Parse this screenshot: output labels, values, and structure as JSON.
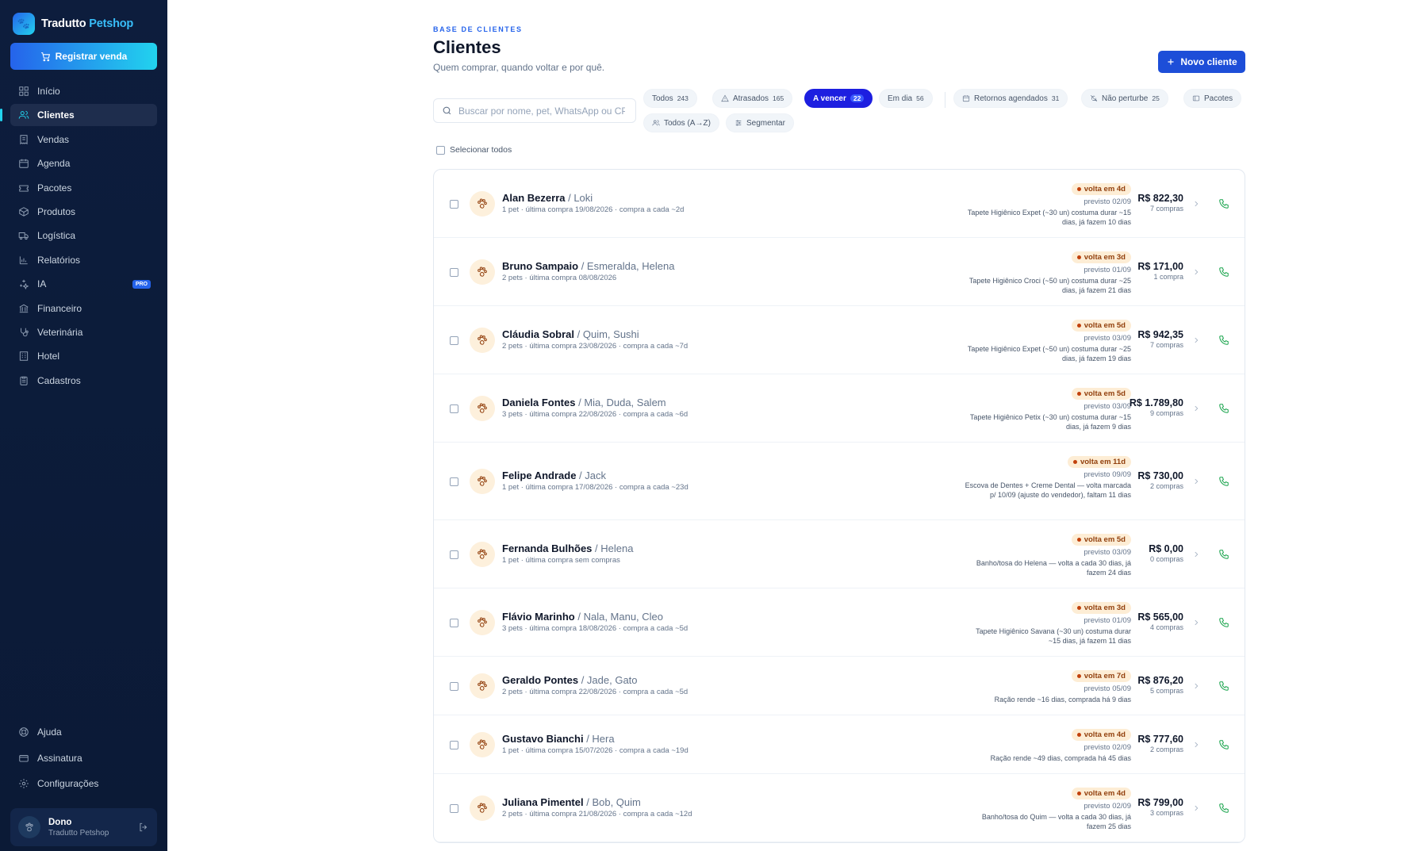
{
  "brand": {
    "name": "Tradutto",
    "accent": "Petshop"
  },
  "sidebar": {
    "register_label": "Registrar venda",
    "items": [
      {
        "label": "Início",
        "icon": "home-icon"
      },
      {
        "label": "Clientes",
        "icon": "users-icon",
        "active": true
      },
      {
        "label": "Vendas",
        "icon": "receipt-icon"
      },
      {
        "label": "Agenda",
        "icon": "calendar-icon"
      },
      {
        "label": "Pacotes",
        "icon": "ticket-icon"
      },
      {
        "label": "Produtos",
        "icon": "box-icon"
      },
      {
        "label": "Logística",
        "icon": "truck-icon"
      },
      {
        "label": "Relatórios",
        "icon": "bar-chart-icon"
      },
      {
        "label": "IA",
        "icon": "sparkles-icon",
        "badge": "PRO"
      },
      {
        "label": "Financeiro",
        "icon": "bank-icon"
      },
      {
        "label": "Veterinária",
        "icon": "stethoscope-icon"
      },
      {
        "label": "Hotel",
        "icon": "building-icon"
      },
      {
        "label": "Cadastros",
        "icon": "clipboard-icon"
      }
    ],
    "bottom_items": [
      {
        "label": "Ajuda",
        "icon": "help-icon"
      },
      {
        "label": "Assinatura",
        "icon": "credit-card-icon"
      },
      {
        "label": "Configurações",
        "icon": "gear-icon"
      }
    ],
    "user": {
      "name": "Dono",
      "sub": "Tradutto Petshop"
    }
  },
  "header": {
    "eyebrow": "BASE DE CLIENTES",
    "title": "Clientes",
    "subtitle": "Quem comprar, quando voltar e por quê.",
    "new_label": "Novo cliente"
  },
  "search": {
    "placeholder": "Buscar por nome, pet, WhatsApp ou CPF"
  },
  "filters": [
    {
      "label": "Todos",
      "count": "243"
    },
    {
      "label": "Atrasados",
      "count": "165",
      "icon": "alert-icon"
    },
    {
      "label": "A vencer",
      "count": "22",
      "active": true
    },
    {
      "label": "Em dia",
      "count": "56"
    },
    {
      "label": "Retornos agendados",
      "count": "31",
      "icon": "calendar-icon"
    },
    {
      "label": "Não perturbe",
      "count": "25",
      "icon": "bell-off-icon"
    },
    {
      "label": "Pacotes",
      "count": "",
      "icon": "package-icon"
    },
    {
      "label": "Todos (A→Z)",
      "count": "",
      "icon": "users-icon"
    },
    {
      "label": "Segmentar",
      "count": "",
      "icon": "sliders-icon"
    }
  ],
  "select_all_label": "Selecionar todos",
  "clients": [
    {
      "name": "Alan Bezerra",
      "pets": "Loki",
      "meta": "1 pet · última compra 19/08/2026 · compra a cada ~2d",
      "badge": "volta em 4d",
      "prev": "previsto 02/09",
      "note": "Tapete Higiênico Expet (~30 un) costuma durar ~15 dias, já fazem 10 dias",
      "amount": "R$ 822,30",
      "purchases": "7 compras"
    },
    {
      "name": "Bruno Sampaio",
      "pets": "Esmeralda, Helena",
      "meta": "2 pets · última compra 08/08/2026",
      "badge": "volta em 3d",
      "prev": "previsto 01/09",
      "note": "Tapete Higiênico Croci (~50 un) costuma durar ~25 dias, já fazem 21 dias",
      "amount": "R$ 171,00",
      "purchases": "1 compra"
    },
    {
      "name": "Cláudia Sobral",
      "pets": "Quim, Sushi",
      "meta": "2 pets · última compra 23/08/2026 · compra a cada ~7d",
      "badge": "volta em 5d",
      "prev": "previsto 03/09",
      "note": "Tapete Higiênico Expet (~50 un) costuma durar ~25 dias, já fazem 19 dias",
      "amount": "R$ 942,35",
      "purchases": "7 compras"
    },
    {
      "name": "Daniela Fontes",
      "pets": "Mia, Duda, Salem",
      "meta": "3 pets · última compra 22/08/2026 · compra a cada ~6d",
      "badge": "volta em 5d",
      "prev": "previsto 03/09",
      "note": "Tapete Higiênico Petix (~30 un) costuma durar ~15 dias, já fazem 9 dias",
      "amount": "R$ 1.789,80",
      "purchases": "9 compras"
    },
    {
      "name": "Felipe Andrade",
      "pets": "Jack",
      "meta": "1 pet · última compra 17/08/2026 · compra a cada ~23d",
      "badge": "volta em 11d",
      "prev": "previsto 09/09",
      "note": "Escova de Dentes + Creme Dental — volta marcada p/ 10/09 (ajuste do vendedor), faltam 11 dias",
      "amount": "R$ 730,00",
      "purchases": "2 compras"
    },
    {
      "name": "Fernanda Bulhões",
      "pets": "Helena",
      "meta": "1 pet · última compra sem compras",
      "badge": "volta em 5d",
      "prev": "previsto 03/09",
      "note": "Banho/tosa do Helena — volta a cada 30 dias, já fazem 24 dias",
      "amount": "R$ 0,00",
      "purchases": "0 compras"
    },
    {
      "name": "Flávio Marinho",
      "pets": "Nala, Manu, Cleo",
      "meta": "3 pets · última compra 18/08/2026 · compra a cada ~5d",
      "badge": "volta em 3d",
      "prev": "previsto 01/09",
      "note": "Tapete Higiênico Savana (~30 un) costuma durar ~15 dias, já fazem 11 dias",
      "amount": "R$ 565,00",
      "purchases": "4 compras"
    },
    {
      "name": "Geraldo Pontes",
      "pets": "Jade, Gato",
      "meta": "2 pets · última compra 22/08/2026 · compra a cada ~5d",
      "badge": "volta em 7d",
      "prev": "previsto 05/09",
      "note": "Ração rende ~16 dias, comprada há 9 dias",
      "amount": "R$ 876,20",
      "purchases": "5 compras"
    },
    {
      "name": "Gustavo Bianchi",
      "pets": "Hera",
      "meta": "1 pet · última compra 15/07/2026 · compra a cada ~19d",
      "badge": "volta em 4d",
      "prev": "previsto 02/09",
      "note": "Ração rende ~49 dias, comprada há 45 dias",
      "amount": "R$ 777,60",
      "purchases": "2 compras"
    },
    {
      "name": "Juliana Pimentel",
      "pets": "Bob, Quim",
      "meta": "2 pets · última compra 21/08/2026 · compra a cada ~12d",
      "badge": "volta em 4d",
      "prev": "previsto 02/09",
      "note": "Banho/tosa do Quim — volta a cada 30 dias, já fazem 25 dias",
      "amount": "R$ 799,00",
      "purchases": "3 compras"
    }
  ]
}
